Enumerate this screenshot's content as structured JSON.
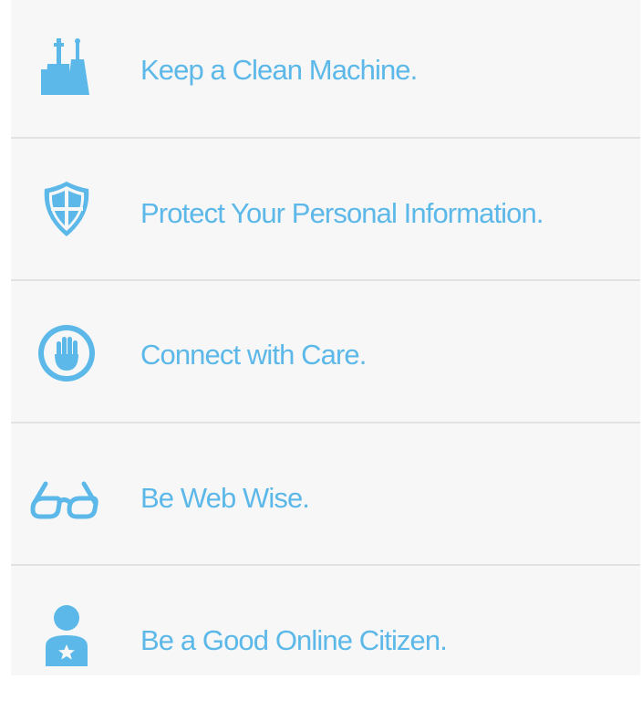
{
  "colors": {
    "accent": "#5bb8e8",
    "background": "#f7f7f7",
    "divider": "#e2e2e2"
  },
  "tips": [
    {
      "icon": "cleaning-tools-icon",
      "label": "Keep a Clean Machine."
    },
    {
      "icon": "shield-icon",
      "label": "Protect Your Personal Information."
    },
    {
      "icon": "stop-hand-icon",
      "label": "Connect with Care."
    },
    {
      "icon": "glasses-icon",
      "label": "Be Web Wise."
    },
    {
      "icon": "citizen-icon",
      "label": "Be a Good Online Citizen."
    }
  ]
}
